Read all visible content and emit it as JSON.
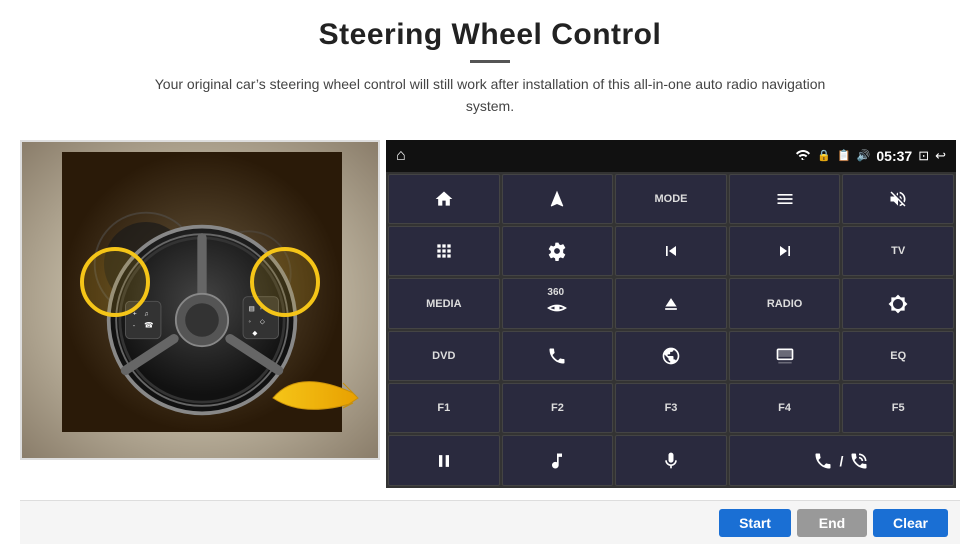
{
  "header": {
    "title": "Steering Wheel Control",
    "subtitle": "Your original car’s steering wheel control will still work after installation of this all-in-one auto radio navigation system."
  },
  "control_panel": {
    "status_bar": {
      "time": "05:37",
      "icons": [
        "wifi",
        "lock",
        "sim",
        "bluetooth",
        "camera",
        "back"
      ]
    },
    "buttons": [
      {
        "id": "btn-home",
        "type": "icon",
        "icon": "house",
        "unicode": "⌂",
        "label": ""
      },
      {
        "id": "btn-nav",
        "type": "icon",
        "icon": "navigation",
        "unicode": "➤",
        "label": ""
      },
      {
        "id": "btn-mode",
        "type": "text",
        "label": "MODE"
      },
      {
        "id": "btn-list",
        "type": "icon",
        "icon": "list",
        "unicode": "☰",
        "label": ""
      },
      {
        "id": "btn-vol-mute",
        "type": "icon",
        "icon": "volume-mute",
        "unicode": "🔇",
        "label": ""
      },
      {
        "id": "btn-apps",
        "type": "icon",
        "icon": "apps",
        "unicode": "⋯",
        "label": ""
      },
      {
        "id": "btn-settings",
        "type": "icon",
        "icon": "settings",
        "unicode": "⚙",
        "label": ""
      },
      {
        "id": "btn-prev",
        "type": "icon",
        "icon": "previous",
        "unicode": "⏮",
        "label": ""
      },
      {
        "id": "btn-next",
        "type": "icon",
        "icon": "next",
        "unicode": "⏭",
        "label": ""
      },
      {
        "id": "btn-tv",
        "type": "text",
        "label": "TV"
      },
      {
        "id": "btn-media",
        "type": "text",
        "label": "MEDIA"
      },
      {
        "id": "btn-360",
        "type": "icon",
        "icon": "360",
        "unicode": "360",
        "label": ""
      },
      {
        "id": "btn-eject",
        "type": "icon",
        "icon": "eject",
        "unicode": "⏏",
        "label": ""
      },
      {
        "id": "btn-radio",
        "type": "text",
        "label": "RADIO"
      },
      {
        "id": "btn-brightness",
        "type": "icon",
        "icon": "brightness",
        "unicode": "☀",
        "label": ""
      },
      {
        "id": "btn-dvd",
        "type": "text",
        "label": "DVD"
      },
      {
        "id": "btn-phone",
        "type": "icon",
        "icon": "phone",
        "unicode": "☎",
        "label": ""
      },
      {
        "id": "btn-www",
        "type": "icon",
        "icon": "internet",
        "unicode": "ⓘ",
        "label": ""
      },
      {
        "id": "btn-screen",
        "type": "icon",
        "icon": "screen",
        "unicode": "▭",
        "label": ""
      },
      {
        "id": "btn-eq",
        "type": "text",
        "label": "EQ"
      },
      {
        "id": "btn-f1",
        "type": "text",
        "label": "F1"
      },
      {
        "id": "btn-f2",
        "type": "text",
        "label": "F2"
      },
      {
        "id": "btn-f3",
        "type": "text",
        "label": "F3"
      },
      {
        "id": "btn-f4",
        "type": "text",
        "label": "F4"
      },
      {
        "id": "btn-f5",
        "type": "text",
        "label": "F5"
      },
      {
        "id": "btn-play-pause",
        "type": "icon",
        "icon": "play-pause",
        "unicode": "⏯",
        "label": ""
      },
      {
        "id": "btn-music",
        "type": "icon",
        "icon": "music",
        "unicode": "♫",
        "label": ""
      },
      {
        "id": "btn-mic",
        "type": "icon",
        "icon": "microphone",
        "unicode": "🎤",
        "label": ""
      },
      {
        "id": "btn-call",
        "type": "icon",
        "icon": "call",
        "unicode": "☎⁄―",
        "label": ""
      }
    ]
  },
  "action_bar": {
    "start_label": "Start",
    "end_label": "End",
    "clear_label": "Clear"
  }
}
